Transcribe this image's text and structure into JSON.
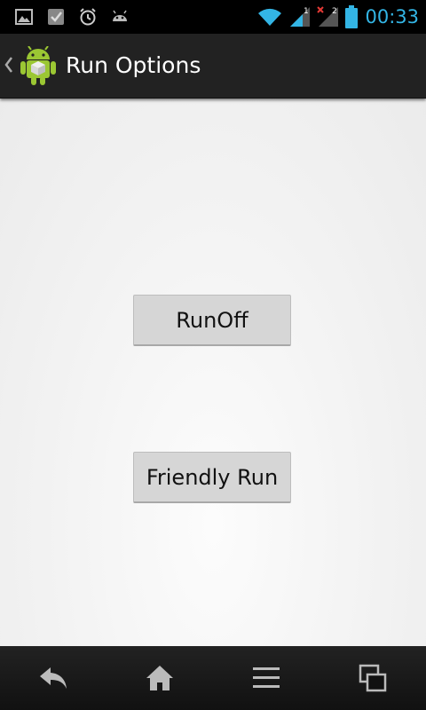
{
  "status_bar": {
    "time": "00:33",
    "sim1_label": "1",
    "sim2_label": "2",
    "icons": [
      "gallery-icon",
      "task-icon",
      "alarm-icon",
      "android-debug-icon",
      "wifi-icon",
      "signal-sim1-icon",
      "signal-sim2-icon",
      "battery-icon"
    ]
  },
  "action_bar": {
    "title": "Run Options",
    "icons": [
      "back-chevron-icon",
      "android-app-icon"
    ]
  },
  "main": {
    "buttons": {
      "runoff": "RunOff",
      "friendly_run": "Friendly Run"
    }
  },
  "nav_bar": {
    "icons": [
      "back-icon",
      "home-icon",
      "menu-icon",
      "recent-apps-icon"
    ]
  },
  "colors": {
    "accent": "#33b5e5",
    "action_bar_bg": "#222222",
    "content_bg": "#f2f2f2",
    "button_bg": "#d6d6d6"
  }
}
